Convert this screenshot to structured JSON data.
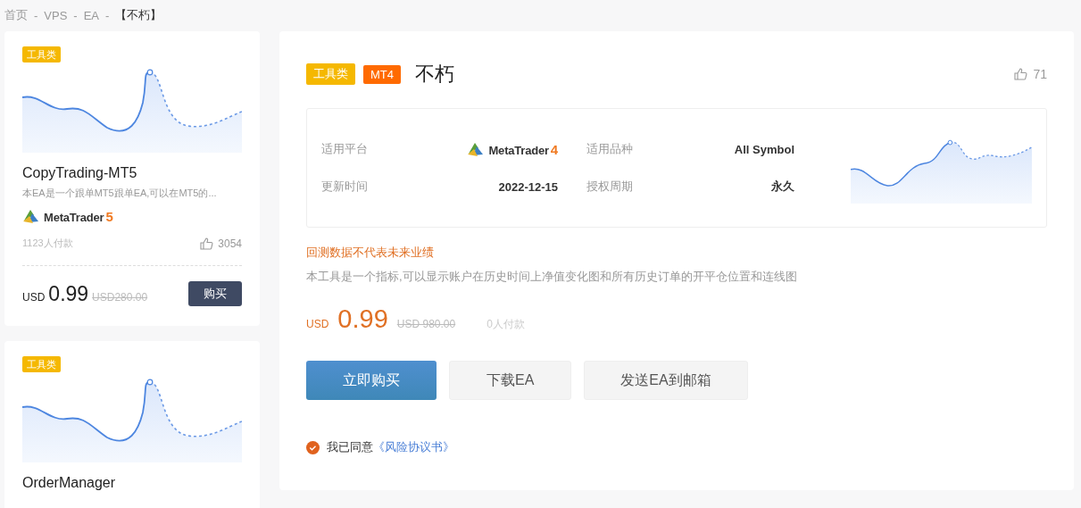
{
  "breadcrumb": {
    "separator": "-",
    "items": [
      {
        "label": "首页",
        "current": false
      },
      {
        "label": "VPS",
        "current": false
      },
      {
        "label": "EA",
        "current": false
      },
      {
        "label": "【不朽】",
        "current": true
      }
    ]
  },
  "cards": [
    {
      "tag": "工具类",
      "title": "CopyTrading-MT5",
      "description": "本EA是一个跟单MT5跟单EA,可以在MT5的...",
      "platform": {
        "name": "MetaTrader",
        "version": "5"
      },
      "buyers": "1123人付款",
      "likes": "3054",
      "currency": "USD",
      "price": "0.99",
      "original_price": "USD280.00",
      "button": "购买"
    },
    {
      "tag": "工具类",
      "title": "OrderManager"
    }
  ],
  "detail": {
    "tags": [
      {
        "label": "工具类",
        "color": "#f5b800"
      },
      {
        "label": "MT4",
        "color": "#ff6a00"
      }
    ],
    "title": "不朽",
    "likes": "71",
    "info": [
      {
        "kind": "platform",
        "label": "适用平台",
        "platform": {
          "name": "MetaTrader",
          "version": "4"
        }
      },
      {
        "kind": "text",
        "label": "适用品种",
        "value": "All Symbol"
      },
      {
        "kind": "text",
        "label": "更新时间",
        "value": "2022-12-15"
      },
      {
        "kind": "text",
        "label": "授权周期",
        "value": "永久"
      }
    ],
    "warning": "回测数据不代表未来业绩",
    "description": "本工具是一个指标,可以显示账户在历史时间上净值变化图和所有历史订单的开平仓位置和连线图",
    "currency": "USD",
    "price": "0.99",
    "original_price": "USD 980.00",
    "buyers": "0人付款",
    "buttons": [
      {
        "label": "立即购买",
        "kind": "primary"
      },
      {
        "label": "下载EA",
        "kind": "secondary"
      },
      {
        "label": "发送EA到邮箱",
        "kind": "secondary"
      }
    ],
    "agreement": {
      "checked": true,
      "text": "我已同意",
      "link": "《风险协议书》"
    }
  }
}
